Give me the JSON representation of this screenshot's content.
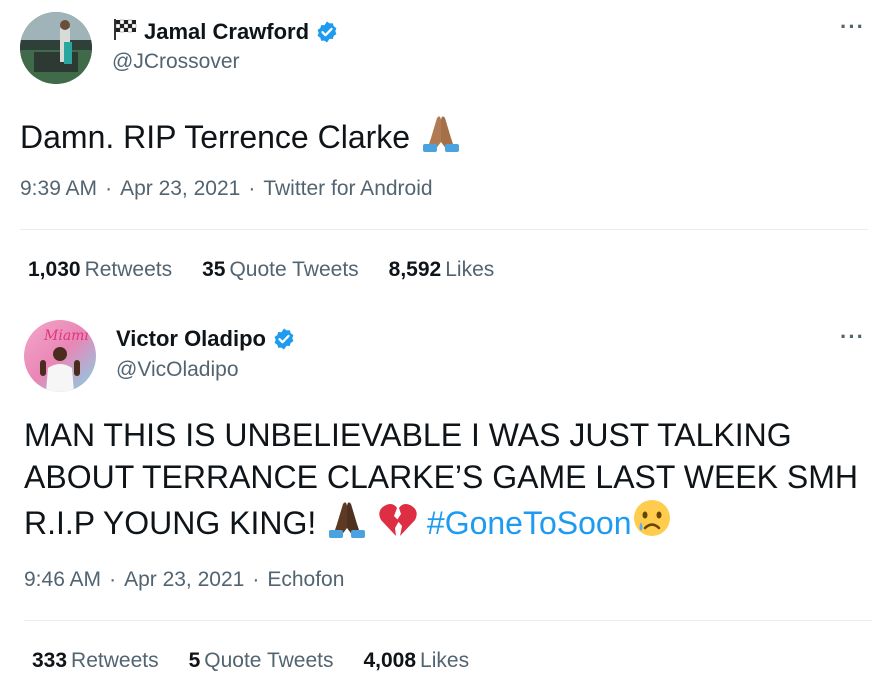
{
  "tweets": [
    {
      "flag_icon": "checkered-flag-icon",
      "display_name": "Jamal Crawford",
      "handle": "@JCrossover",
      "text": "Damn. RIP Terrence Clarke",
      "time": "9:39 AM",
      "date": "Apr 23, 2021",
      "source": "Twitter for Android",
      "sep": "·",
      "more": "···",
      "stats": {
        "retweets_count": "1,030",
        "retweets_label": "Retweets",
        "quotes_count": "35",
        "quotes_label": "Quote Tweets",
        "likes_count": "8,592",
        "likes_label": "Likes"
      }
    },
    {
      "display_name": "Victor Oladipo",
      "handle": "@VicOladipo",
      "text_line1": "MAN THIS IS UNBELIEVABLE I WAS JUST TALKING",
      "text_line2": "ABOUT TERRANCE CLARKE’S GAME LAST WEEK SMH",
      "text_line3": "R.I.P YOUNG KING!",
      "hashtag": "#GoneToSoon",
      "avatar_text": "Miami",
      "time": "9:46 AM",
      "date": "Apr 23, 2021",
      "source": "Echofon",
      "sep": "·",
      "more": "···",
      "stats": {
        "retweets_count": "333",
        "retweets_label": "Retweets",
        "quotes_count": "5",
        "quotes_label": "Quote Tweets",
        "likes_count": "4,008",
        "likes_label": "Likes"
      }
    }
  ],
  "colors": {
    "verified": "#1d9bf0",
    "hashtag": "#1d9bf0",
    "secondary_text": "#536471"
  }
}
